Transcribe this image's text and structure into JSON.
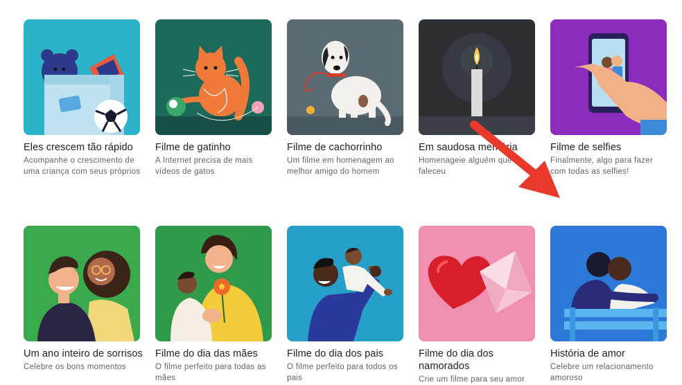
{
  "cards": [
    {
      "title": "Eles crescem tão rápido",
      "desc": "Acompanhe o crescimento de uma criança com seus próprios"
    },
    {
      "title": "Filme de gatinho",
      "desc": "A Internet precisa de mais vídeos de gatos"
    },
    {
      "title": "Filme de cachorrinho",
      "desc": "Um filme em homenagem ao melhor amigo do homem"
    },
    {
      "title": "Em saudosa memória",
      "desc": "Homenageie alguém que faleceu"
    },
    {
      "title": "Filme de selfies",
      "desc": "Finalmente, algo para fazer com todas as selfies!"
    },
    {
      "title": "Um ano inteiro de sorrisos",
      "desc": "Celebre os bons momentos"
    },
    {
      "title": "Filme do dia das mães",
      "desc": "O filme perfeito para todas as mães"
    },
    {
      "title": "Filme do dia dos pais",
      "desc": "O filme perfeito para todos os pais"
    },
    {
      "title": "Filme do dia dos namorados",
      "desc": "Crie um filme para seu amor"
    },
    {
      "title": "História de amor",
      "desc": "Celebre um relacionamento amoroso"
    }
  ],
  "colors": {
    "card_bg": [
      "#2bb3c9",
      "#1c6a5a",
      "#5b6b73",
      "#2a2f33",
      "#8e2bbf",
      "#39a94c",
      "#2f9a4a",
      "#27a0c9",
      "#f08fb0",
      "#2b78d6"
    ],
    "annotation_arrow": "#e8392b"
  }
}
